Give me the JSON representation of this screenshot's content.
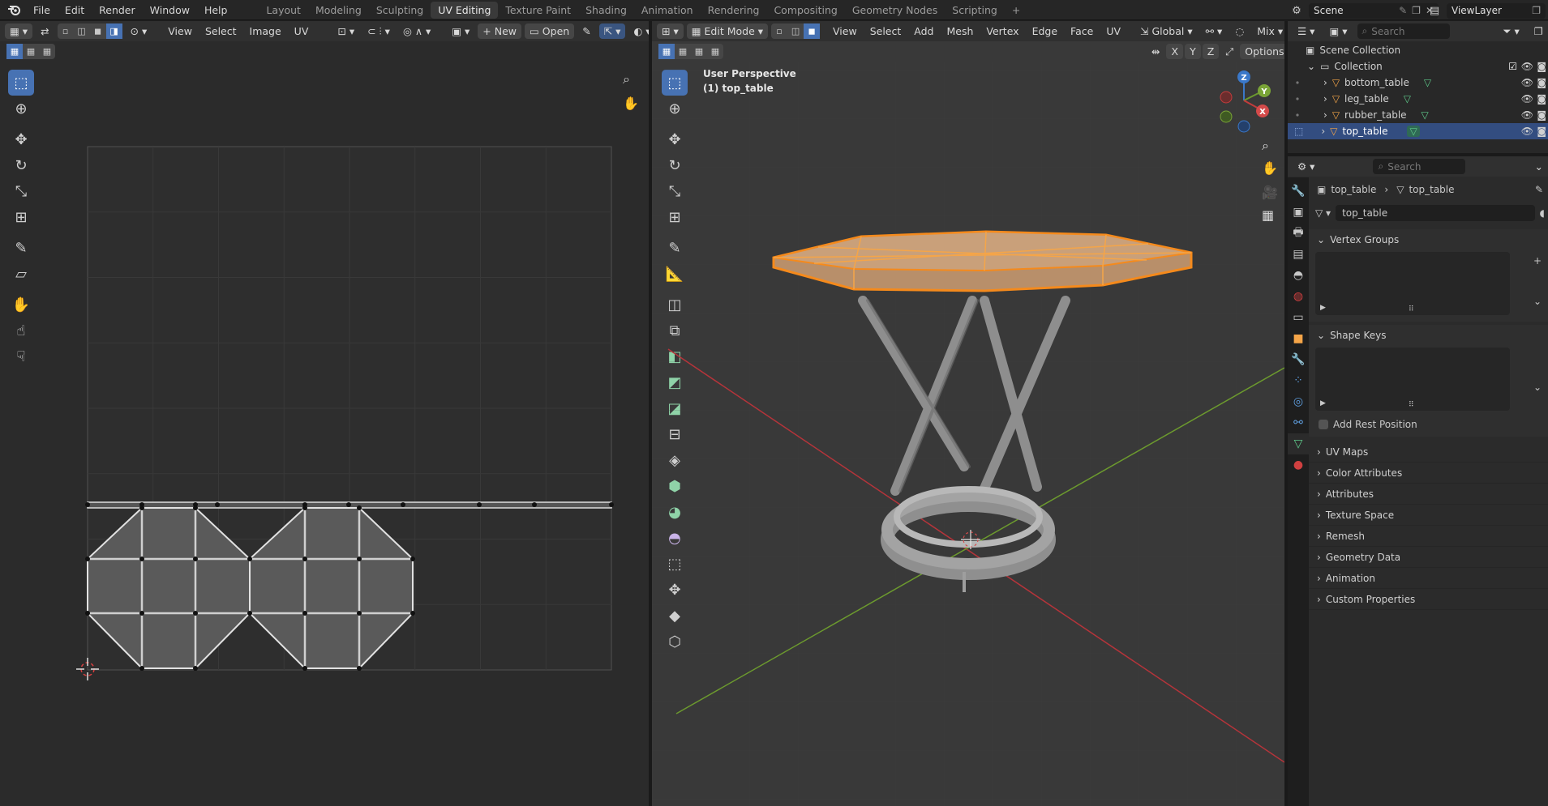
{
  "menu": {
    "items": [
      "File",
      "Edit",
      "Render",
      "Window",
      "Help"
    ],
    "workspaces": [
      "Layout",
      "Modeling",
      "Sculpting",
      "UV Editing",
      "Texture Paint",
      "Shading",
      "Animation",
      "Rendering",
      "Compositing",
      "Geometry Nodes",
      "Scripting"
    ],
    "active_workspace": "UV Editing",
    "add_tab": "+",
    "scene": "Scene",
    "view_layer": "ViewLayer"
  },
  "uv_editor": {
    "menus": [
      "View",
      "Select",
      "Image",
      "UV"
    ],
    "new_label": "New",
    "open_label": "Open"
  },
  "viewport": {
    "mode": "Edit Mode",
    "menus": [
      "View",
      "Select",
      "Add",
      "Mesh",
      "Vertex",
      "Edge",
      "Face",
      "UV"
    ],
    "orientation": "Global",
    "shading": "Mix",
    "options_label": "Options",
    "axis_labels": {
      "x": "X",
      "y": "Y",
      "z": "Z"
    },
    "overlay_title": "User Perspective",
    "overlay_object": "(1) top_table",
    "gizmo": {
      "z": "Z",
      "y": "Y",
      "x": "X"
    },
    "colors": {
      "selection": "#f58a1c",
      "face_fill": "#c2956a",
      "x_axis": "#b5343a",
      "y_axis": "#6c9a2e"
    }
  },
  "outliner": {
    "search_placeholder": "Search",
    "scene_collection": "Scene Collection",
    "collection": "Collection",
    "objects": [
      {
        "name": "bottom_table",
        "selected": false
      },
      {
        "name": "leg_table",
        "selected": false
      },
      {
        "name": "rubber_table",
        "selected": false
      },
      {
        "name": "top_table",
        "selected": true
      }
    ]
  },
  "properties": {
    "search_placeholder": "Search",
    "breadcrumb_object": "top_table",
    "breadcrumb_data": "top_table",
    "data_name": "top_table",
    "vertex_groups_label": "Vertex Groups",
    "shape_keys_label": "Shape Keys",
    "add_rest_position_label": "Add Rest Position",
    "collapsed_sections": [
      "UV Maps",
      "Color Attributes",
      "Attributes",
      "Texture Space",
      "Remesh",
      "Geometry Data",
      "Animation",
      "Custom Properties"
    ]
  }
}
